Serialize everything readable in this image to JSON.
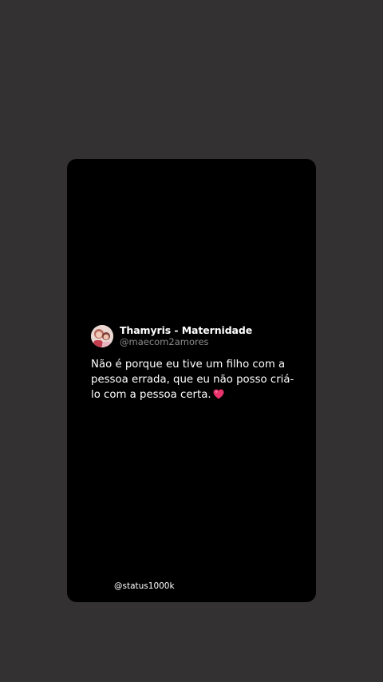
{
  "tweet": {
    "author_name": "Thamyris - Maternidade",
    "author_handle": "@maecom2amores",
    "text": "Não é porque eu tive um filho com a pessoa errada, que eu não posso criá-lo com a pessoa certa.",
    "emoji_icon": "pink-heart-icon"
  },
  "footer": {
    "handle": "@status1000k"
  },
  "colors": {
    "background": "#333132",
    "card": "#000000",
    "heart": "#e8336b",
    "handle_gray": "#8b8b8b"
  }
}
